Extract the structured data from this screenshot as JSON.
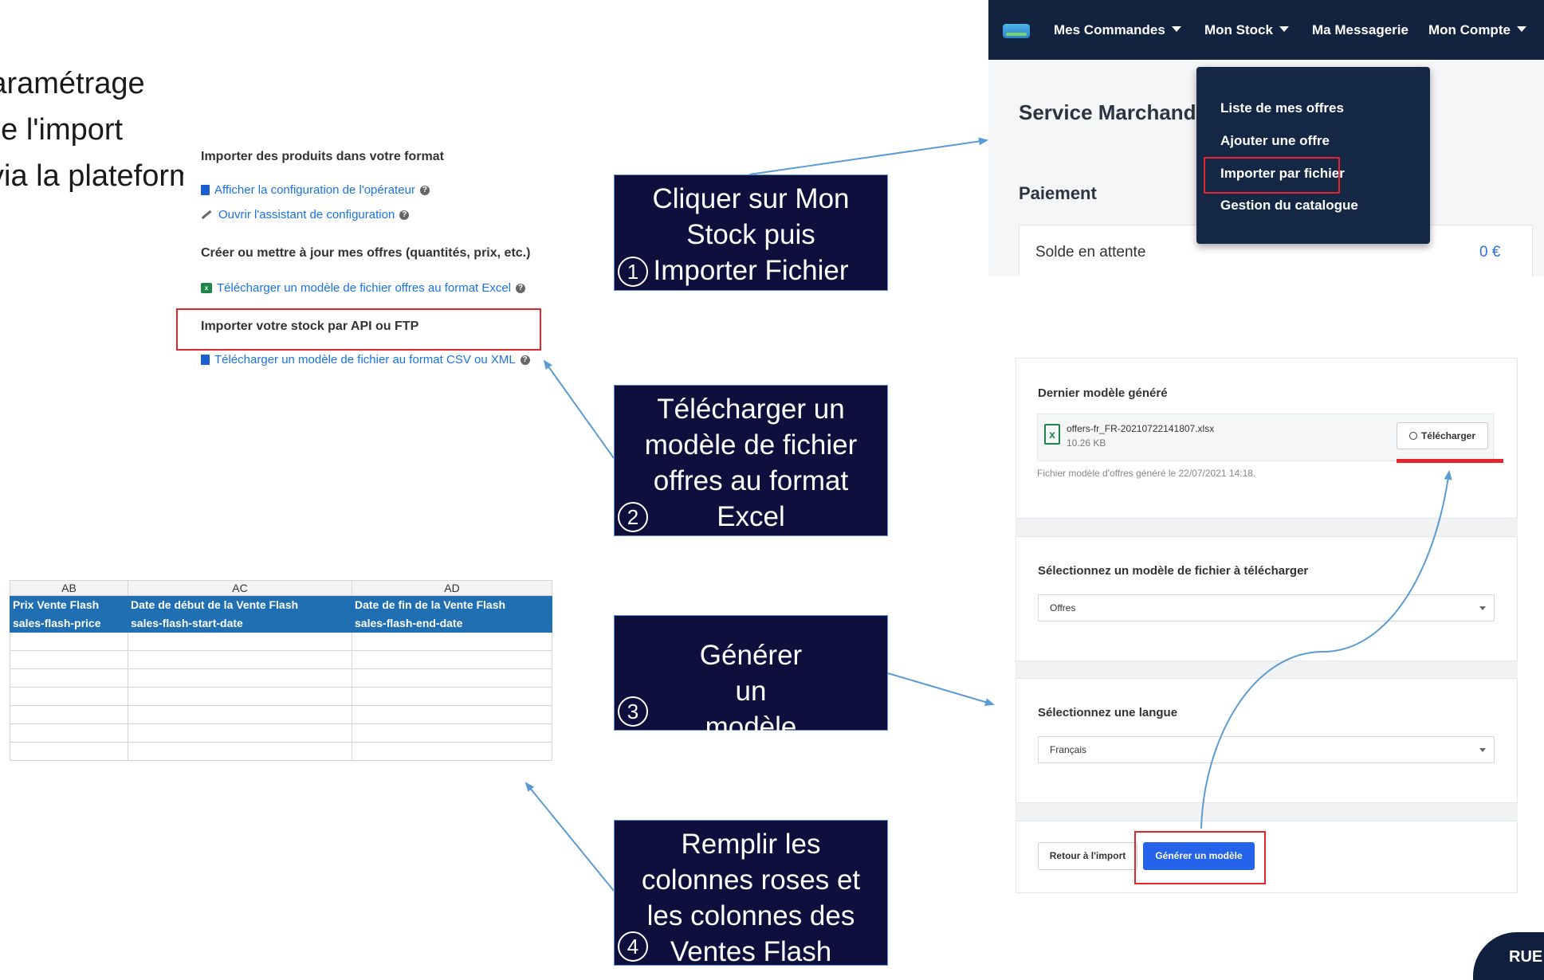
{
  "slide_title": {
    "line1": "Paramétrage",
    "line2": "de l'import",
    "line3": "via la plateforme Mirakl"
  },
  "import_options": {
    "heading1": "Importer des produits dans votre format",
    "link1": "Afficher la configuration de l'opérateur",
    "link2": "Ouvrir l'assistant de configuration",
    "heading2": "Créer ou mettre à jour mes offres (quantités, prix, etc.)",
    "link3": "Télécharger un modèle de fichier offres au format Excel",
    "heading3": "Importer votre stock par API ou FTP",
    "link4": "Télécharger un modèle de fichier au format CSV ou XML"
  },
  "steps": [
    {
      "number": "1",
      "text": "Cliquer sur Mon Stock puis Importer Fichier"
    },
    {
      "number": "2",
      "text": "Télécharger un modèle de fichier offres au format Excel"
    },
    {
      "number": "3",
      "text": "Générer un modèle"
    },
    {
      "number": "4",
      "text": "Remplir les colonnes roses et les colonnes des Ventes Flash"
    }
  ],
  "nav": {
    "items": [
      "Mes Commandes",
      "Mon Stock",
      "Ma Messagerie",
      "Mon Compte"
    ],
    "page_title": "Service Marchand",
    "section": "Paiement",
    "solde_label": "Solde en attente",
    "solde_value": "0 €",
    "dropdown": [
      "Liste de mes offres",
      "Ajouter une offre",
      "Importer par fichier",
      "Gestion du catalogue"
    ]
  },
  "spreadsheet": {
    "col_letters": [
      "AB",
      "AC",
      "AD"
    ],
    "header_row1": [
      "Prix Vente Flash",
      "Date de début de la Vente Flash",
      "Date de fin de la Vente Flash"
    ],
    "header_row2": [
      "sales-flash-price",
      "sales-flash-start-date",
      "sales-flash-end-date"
    ],
    "empty_rows": 7
  },
  "model_gen": {
    "last_title": "Dernier modèle généré",
    "file_name": "offers-fr_FR-20210722141807.xlsx",
    "file_size": "10.26 KB",
    "download_label": "Télécharger",
    "file_note": "Fichier modèle d'offres généré le 22/07/2021 14:18.",
    "select_type_title": "Sélectionnez un modèle de fichier à télécharger",
    "select_type_value": "Offres",
    "select_lang_title": "Sélectionnez une langue",
    "select_lang_value": "Français",
    "back_label": "Retour à l'import",
    "generate_label": "Générer un modèle"
  },
  "brand": "RUE",
  "colors": {
    "step_box": "#0e0f3d",
    "highlight": "#e3262e",
    "nav": "#12233f",
    "link": "#1a73e8",
    "arrow": "#5b9bd5",
    "primary_button": "#2563eb"
  }
}
